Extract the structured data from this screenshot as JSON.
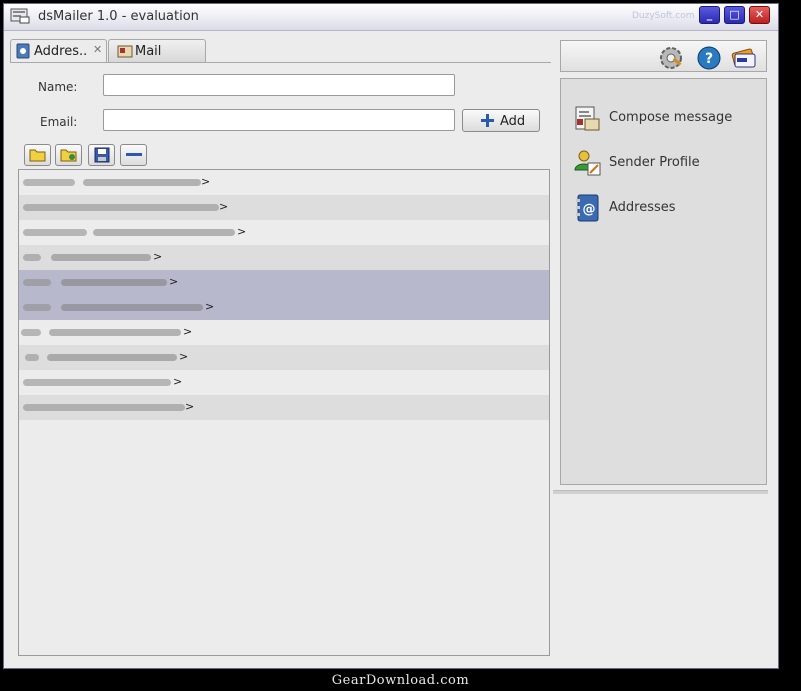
{
  "window": {
    "title": "dsMailer 1.0 - evaluation",
    "brand": "DuzySoft.com",
    "min_label": "_",
    "max_label": "□",
    "close_label": "✕"
  },
  "tabs": [
    {
      "label": "Addres..",
      "active": true,
      "closable": true
    },
    {
      "label": "Mail",
      "active": false
    }
  ],
  "tab_close_glyph": "✕",
  "form": {
    "name_label": "Name:",
    "email_label": "Email:",
    "name_value": "",
    "email_value": "",
    "add_button": "Add"
  },
  "list_toolbar": {
    "icons": [
      "open-folder-icon",
      "import-folder-icon",
      "save-icon",
      "remove-icon"
    ]
  },
  "contacts": {
    "rows": [
      {
        "tail": ">"
      },
      {
        "tail": ">"
      },
      {
        "tail": ">"
      },
      {
        "tail": ">"
      },
      {
        "tail": ">"
      },
      {
        "tail": ">"
      },
      {
        "tail": ">"
      },
      {
        "tail": ">"
      },
      {
        "tail": ">"
      },
      {
        "tail": ">"
      }
    ]
  },
  "right_panel": {
    "toolbar_icons": [
      "settings-icon",
      "help-icon",
      "buy-card-icon"
    ],
    "actions": [
      {
        "label": "Compose message",
        "icon": "compose-message-icon"
      },
      {
        "label": "Sender Profile",
        "icon": "sender-profile-icon"
      },
      {
        "label": "Addresses",
        "icon": "address-book-icon"
      }
    ]
  },
  "colors": {
    "selected_row": "#b8b8cc",
    "title_buttons": "#2a2ab0",
    "close_button": "#b82020"
  },
  "watermark": "GearDownload.com"
}
